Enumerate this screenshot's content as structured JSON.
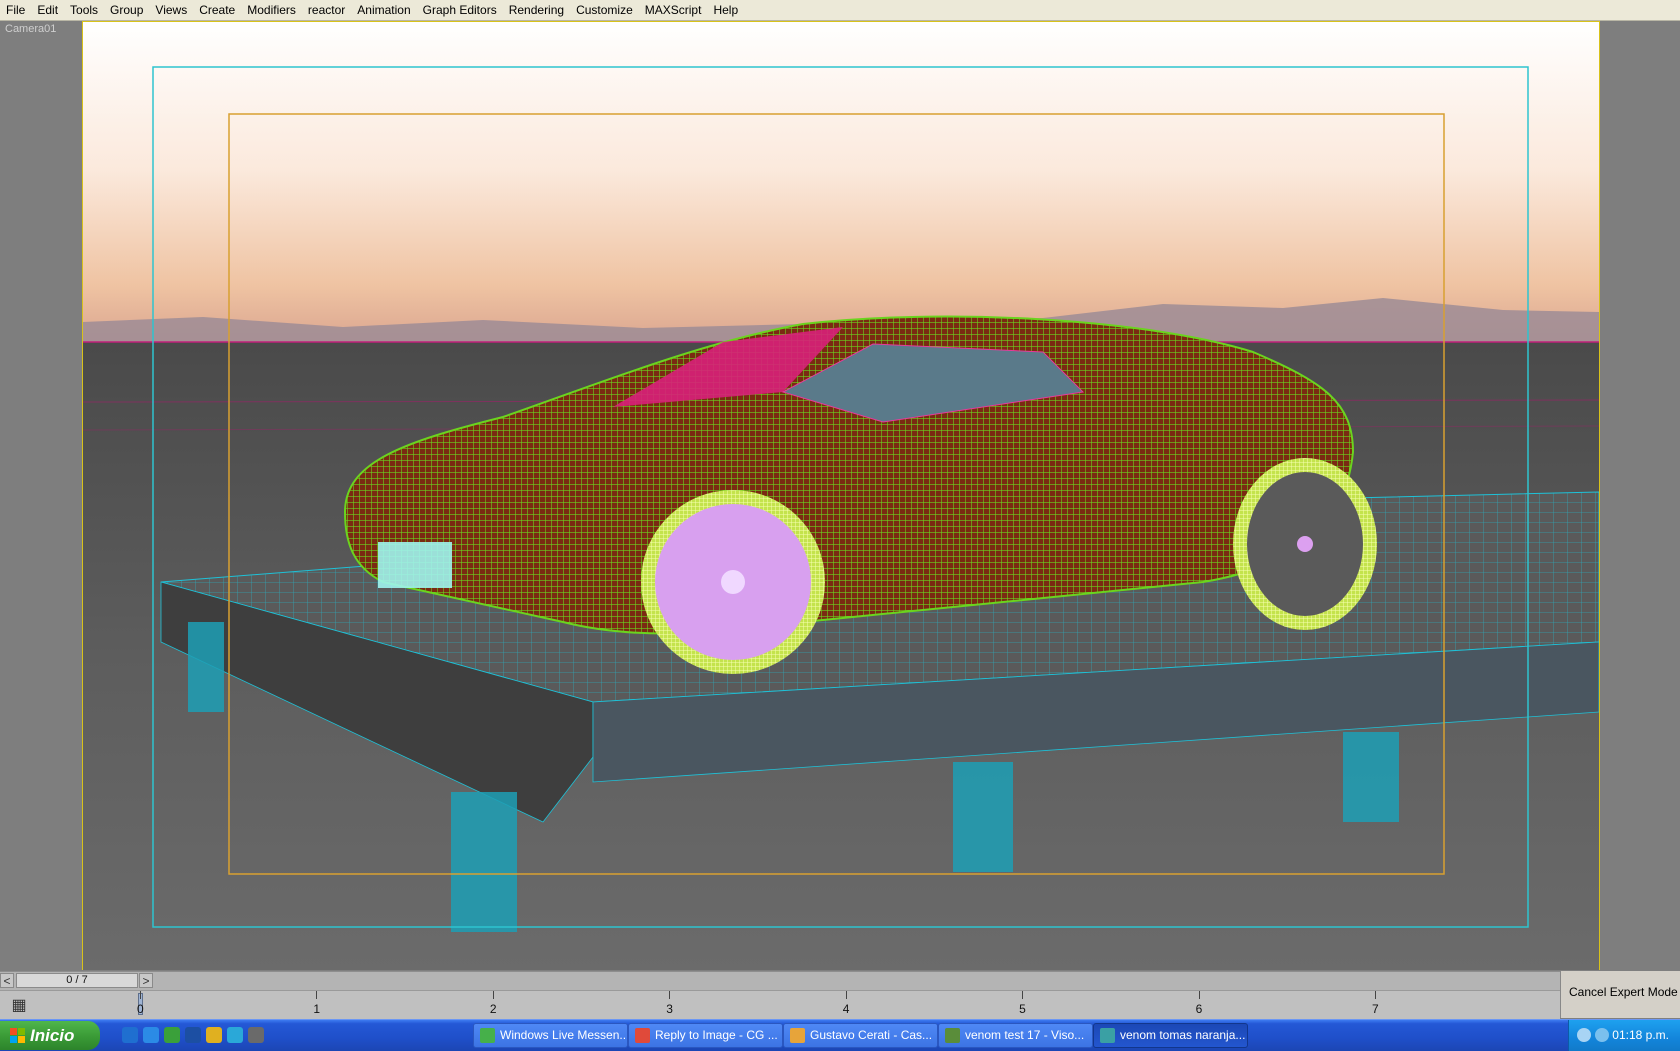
{
  "menu": [
    "File",
    "Edit",
    "Tools",
    "Group",
    "Views",
    "Create",
    "Modifiers",
    "reactor",
    "Animation",
    "Graph Editors",
    "Rendering",
    "Customize",
    "MAXScript",
    "Help"
  ],
  "viewport": {
    "label": "Camera01"
  },
  "timeslider": {
    "position": "0 / 7",
    "prev_glyph": "<",
    "next_glyph": ">",
    "current_frame": 0,
    "total_frames": 7
  },
  "trackbar": {
    "ticks": [
      "0",
      "1",
      "2",
      "3",
      "4",
      "5",
      "6",
      "7"
    ]
  },
  "expert": {
    "label": "Cancel Expert Mode"
  },
  "taskbar": {
    "start_label": "Inicio",
    "quicklaunch": [
      "ie-icon",
      "browser-icon",
      "photoshop-icon",
      "messenger-icon",
      "chrome-icon",
      "skype-icon",
      "app-icon"
    ],
    "tasks": [
      {
        "label": "Windows Live Messen...",
        "icon_color": "#46b04a",
        "active": false
      },
      {
        "label": "Reply to Image - CG ...",
        "icon_color": "#e04a3a",
        "active": false
      },
      {
        "label": "Gustavo Cerati - Cas...",
        "icon_color": "#e7a43a",
        "active": false
      },
      {
        "label": "venom test 17  - Viso...",
        "icon_color": "#5a8d3a",
        "active": false
      },
      {
        "label": "venom tomas naranja...",
        "icon_color": "#3aa0a4",
        "active": true
      }
    ],
    "clock": "01:18 p.m."
  },
  "colors": {
    "safe_frame_outer": "#2ec4cf",
    "safe_frame_inner": "#d8a030",
    "car_wire": "#6bd41e",
    "glass": "#d8207a",
    "deck_wire": "#1ec2d8",
    "wheel": "#e6f47a",
    "rim": "#dca0f0"
  }
}
